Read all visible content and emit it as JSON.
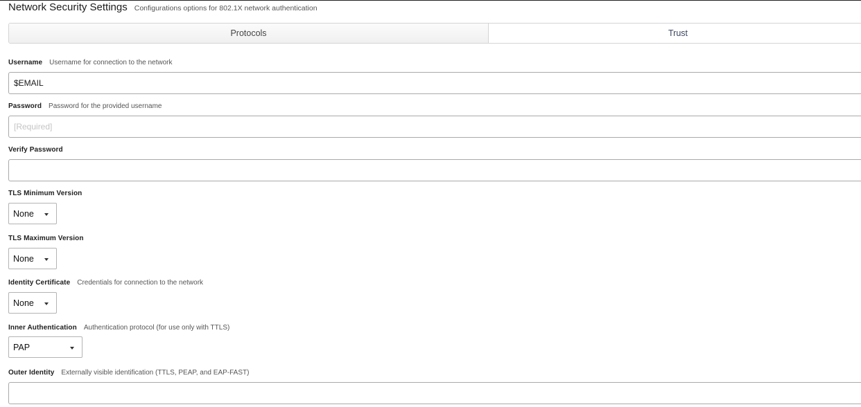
{
  "header": {
    "title": "Network Security Settings",
    "subtitle": "Configurations options for 802.1X network authentication"
  },
  "tabs": [
    {
      "label": "Protocols"
    },
    {
      "label": "Trust"
    }
  ],
  "fields": {
    "username": {
      "label": "Username",
      "hint": "Username for connection to the network",
      "value": "$EMAIL"
    },
    "password": {
      "label": "Password",
      "hint": "Password for the provided username",
      "placeholder": "[Required]"
    },
    "verify_password": {
      "label": "Verify Password"
    },
    "tls_min": {
      "label": "TLS Minimum Version",
      "selected": "None"
    },
    "tls_max": {
      "label": "TLS Maximum Version",
      "selected": "None"
    },
    "identity_certificate": {
      "label": "Identity Certificate",
      "hint": "Credentials for connection to the network",
      "selected": "None"
    },
    "inner_authentication": {
      "label": "Inner Authentication",
      "hint": "Authentication protocol (for use only with TTLS)",
      "selected": "PAP"
    },
    "outer_identity": {
      "label": "Outer Identity",
      "hint": "Externally visible identification (TTLS, PEAP, and EAP-FAST)"
    }
  },
  "icons": {
    "select_caret": "chevron-down-icon"
  }
}
